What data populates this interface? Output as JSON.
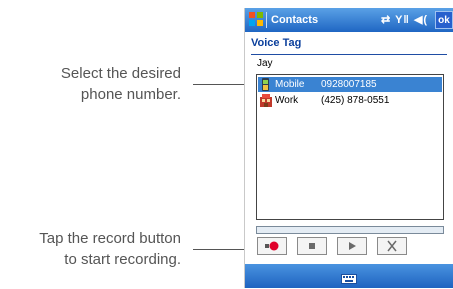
{
  "callouts": {
    "select": [
      "Select the desired",
      "phone number."
    ],
    "record": [
      "Tap the record button",
      "to start recording."
    ]
  },
  "window": {
    "title": "Contacts",
    "ok_label": "ok",
    "status_icons": [
      "sync-icon",
      "signal-icon",
      "volume-icon"
    ]
  },
  "voice_tag": {
    "heading": "Voice Tag",
    "contact_name": "Jay",
    "numbers": [
      {
        "label": "Mobile",
        "number": "0928007185",
        "icon": "mobile-phone-icon",
        "selected": true
      },
      {
        "label": "Work",
        "number": "(425) 878-0551",
        "icon": "work-building-icon",
        "selected": false
      }
    ]
  },
  "controls": [
    "record-icon",
    "stop-icon",
    "play-icon",
    "delete-icon"
  ],
  "menubar": {
    "icon": "keyboard-icon"
  },
  "colors": {
    "title_bar": "#2a74d2",
    "selection": "#3a83d2",
    "record_red": "#e0002a",
    "heading_blue": "#0b3f9c",
    "callout_text": "#555555"
  }
}
